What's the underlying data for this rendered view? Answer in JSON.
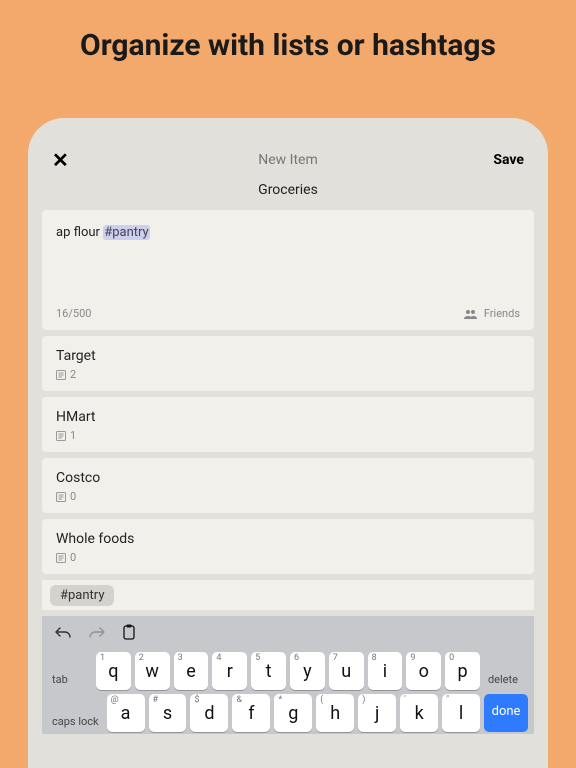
{
  "marketing": {
    "title": "Organize with lists or hashtags"
  },
  "topbar": {
    "close_label": "✕",
    "center_title": "New Item",
    "save_label": "Save"
  },
  "subheader": {
    "list_name": "Groceries"
  },
  "compose": {
    "text_plain": "ap flour ",
    "hashtag": "#pantry",
    "counter": "16/500",
    "share_scope": "Friends"
  },
  "lists": [
    {
      "name": "Target",
      "count": "2"
    },
    {
      "name": "HMart",
      "count": "1"
    },
    {
      "name": "Costco",
      "count": "0"
    },
    {
      "name": "Whole foods",
      "count": "0"
    }
  ],
  "suggestion": {
    "text": "#pantry"
  },
  "keyboard": {
    "tab": "tab",
    "delete": "delete",
    "caps": "caps lock",
    "done": "done",
    "row1": [
      {
        "main": "q",
        "alt": "1"
      },
      {
        "main": "w",
        "alt": "2"
      },
      {
        "main": "e",
        "alt": "3"
      },
      {
        "main": "r",
        "alt": "4"
      },
      {
        "main": "t",
        "alt": "5"
      },
      {
        "main": "y",
        "alt": "6"
      },
      {
        "main": "u",
        "alt": "7"
      },
      {
        "main": "i",
        "alt": "8"
      },
      {
        "main": "o",
        "alt": "9"
      },
      {
        "main": "p",
        "alt": "0"
      }
    ],
    "row2": [
      {
        "main": "a",
        "alt": "@"
      },
      {
        "main": "s",
        "alt": "#"
      },
      {
        "main": "d",
        "alt": "$"
      },
      {
        "main": "f",
        "alt": "&"
      },
      {
        "main": "g",
        "alt": "*"
      },
      {
        "main": "h",
        "alt": "("
      },
      {
        "main": "j",
        "alt": ")"
      },
      {
        "main": "k",
        "alt": "'"
      },
      {
        "main": "l",
        "alt": "\""
      }
    ]
  }
}
